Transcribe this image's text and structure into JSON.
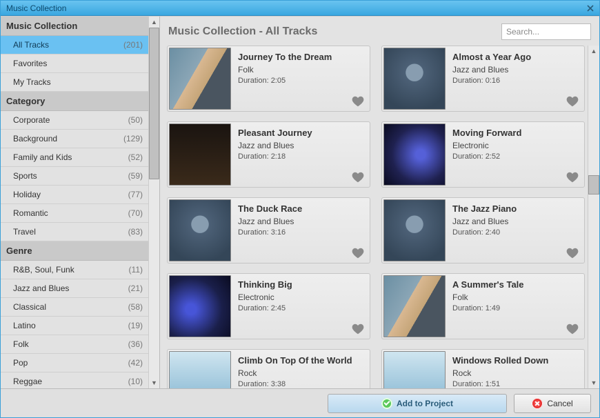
{
  "window": {
    "title": "Music Collection"
  },
  "sidebar": {
    "sections": [
      {
        "header": "Music Collection",
        "items": [
          {
            "label": "All Tracks",
            "count": "(201)",
            "selected": true
          },
          {
            "label": "Favorites",
            "count": ""
          },
          {
            "label": "My Tracks",
            "count": ""
          }
        ]
      },
      {
        "header": "Category",
        "items": [
          {
            "label": "Corporate",
            "count": "(50)"
          },
          {
            "label": "Background",
            "count": "(129)"
          },
          {
            "label": "Family and Kids",
            "count": "(52)"
          },
          {
            "label": "Sports",
            "count": "(59)"
          },
          {
            "label": "Holiday",
            "count": "(77)"
          },
          {
            "label": "Romantic",
            "count": "(70)"
          },
          {
            "label": "Travel",
            "count": "(83)"
          }
        ]
      },
      {
        "header": "Genre",
        "items": [
          {
            "label": "R&B, Soul, Funk",
            "count": "(11)"
          },
          {
            "label": "Jazz and Blues",
            "count": "(21)"
          },
          {
            "label": "Classical",
            "count": "(58)"
          },
          {
            "label": "Latino",
            "count": "(19)"
          },
          {
            "label": "Folk",
            "count": "(36)"
          },
          {
            "label": "Pop",
            "count": "(42)"
          },
          {
            "label": "Reggae",
            "count": "(10)"
          }
        ]
      }
    ]
  },
  "main": {
    "title": "Music Collection - All Tracks",
    "search_placeholder": "Search...",
    "tracks": [
      {
        "title": "Journey To the Dream",
        "genre": "Folk",
        "duration": "Duration: 2:05",
        "thumb": "th-guitar"
      },
      {
        "title": "Almost a Year Ago",
        "genre": "Jazz and Blues",
        "duration": "Duration: 0:16",
        "thumb": "th-mic"
      },
      {
        "title": "Pleasant Journey",
        "genre": "Jazz and Blues",
        "duration": "Duration: 2:18",
        "thumb": "th-dancer"
      },
      {
        "title": "Moving Forward",
        "genre": "Electronic",
        "duration": "Duration: 2:52",
        "thumb": "th-dj2"
      },
      {
        "title": "The Duck Race",
        "genre": "Jazz and Blues",
        "duration": "Duration: 3:16",
        "thumb": "th-mic"
      },
      {
        "title": "The Jazz Piano",
        "genre": "Jazz and Blues",
        "duration": "Duration: 2:40",
        "thumb": "th-mic"
      },
      {
        "title": "Thinking Big",
        "genre": "Electronic",
        "duration": "Duration: 2:45",
        "thumb": "th-dj"
      },
      {
        "title": "A Summer's Tale",
        "genre": "Folk",
        "duration": "Duration: 1:49",
        "thumb": "th-guitar"
      },
      {
        "title": "Climb On Top Of the World",
        "genre": "Rock",
        "duration": "Duration: 3:38",
        "thumb": "th-water"
      },
      {
        "title": "Windows Rolled Down",
        "genre": "Rock",
        "duration": "Duration: 1:51",
        "thumb": "th-water"
      }
    ]
  },
  "footer": {
    "add_label": "Add to Project",
    "cancel_label": "Cancel"
  }
}
